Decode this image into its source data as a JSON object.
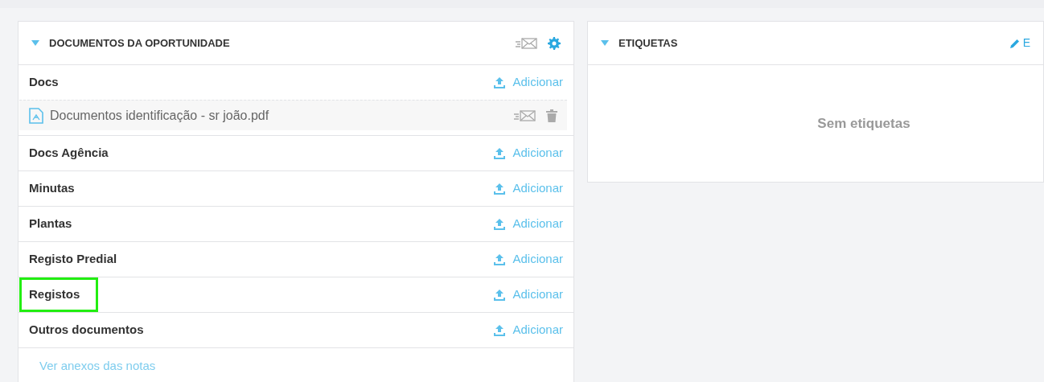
{
  "documents_panel": {
    "title": "DOCUMENTOS DA OPORTUNIDADE",
    "expanded": true,
    "categories": [
      {
        "name": "Docs",
        "add_label": "Adicionar",
        "highlighted": false,
        "files": [
          {
            "name": "Documentos identificação - sr joão.pdf"
          }
        ]
      },
      {
        "name": "Docs Agência",
        "add_label": "Adicionar",
        "highlighted": false
      },
      {
        "name": "Minutas",
        "add_label": "Adicionar",
        "highlighted": false
      },
      {
        "name": "Plantas",
        "add_label": "Adicionar",
        "highlighted": false
      },
      {
        "name": "Registo Predial",
        "add_label": "Adicionar",
        "highlighted": false
      },
      {
        "name": "Registos",
        "add_label": "Adicionar",
        "highlighted": true
      },
      {
        "name": "Outros documentos",
        "add_label": "Adicionar",
        "highlighted": false
      }
    ],
    "footer_link": "Ver anexos das notas"
  },
  "tags_panel": {
    "title": "ETIQUETAS",
    "expanded": true,
    "edit_label": "E",
    "empty_text": "Sem etiquetas"
  }
}
